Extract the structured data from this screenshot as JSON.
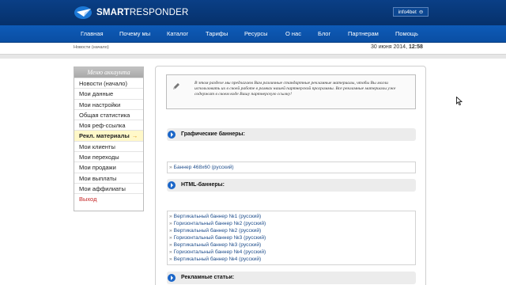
{
  "header": {
    "brand_bold": "SMART",
    "brand_thin": "RESPONDER",
    "user": "info4bet",
    "logout_icon": "⊖"
  },
  "nav": [
    "Главная",
    "Почему мы",
    "Каталог",
    "Тарифы",
    "Ресурсы",
    "О нас",
    "Блог",
    "Партнерам",
    "Помощь"
  ],
  "breadcrumb": "Новости (начало)",
  "date": "30 июня 2014,",
  "time": "12:58",
  "menu": {
    "title": "Меню аккаунта",
    "items": [
      "Новости (начало)",
      "Мои данные",
      "Мои настройки",
      "Общая статистика",
      "Моя реф-ссылка",
      "Рекл. материалы",
      "Мои клиенты",
      "Мои переходы",
      "Мои продажи",
      "Мои выплаты",
      "Мои аффилиаты",
      "Выход"
    ],
    "active_arrow": "→"
  },
  "info": "В этом разделе мы предлагаем Вам различные стандартные рекламные материалы, чтобы Вы могли использовать их в своей работе в рамках нашей партнерской программы. Все рекламные материалы уже содержат в своем коде Вашу партнерскую ссылку!",
  "sections": {
    "graphic": "Графические баннеры:",
    "html": "HTML-баннеры:",
    "articles": "Рекламные статьи:"
  },
  "bullet": "»",
  "graphic_links": [
    "Баннер 468x60 (русский)"
  ],
  "html_links": [
    "Вертикальный баннер №1 (русский)",
    "Горизонтальный баннер №2 (русский)",
    "Вертикальный баннер №2 (русский)",
    "Горизонтальный баннер №3 (русский)",
    "Вертикальный баннер №3 (русский)",
    "Горизонтальный баннер №4 (русский)",
    "Вертикальный баннер №4 (русский)"
  ],
  "colors": {
    "header": "#0a3f86",
    "navbar": "#0e5bb8",
    "link": "#1f4e8c",
    "exit": "#c62828",
    "active_menu_bg": "#fff8c9"
  }
}
